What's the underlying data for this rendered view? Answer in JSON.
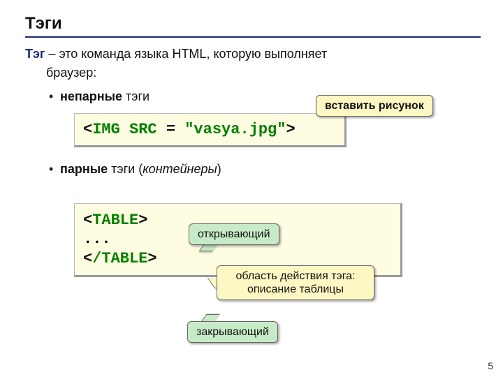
{
  "title": "Тэги",
  "definition": {
    "term": "Тэг",
    "text_after_term": " – это команда языка HTML, которую выполняет",
    "line2": "браузер:"
  },
  "bullets": {
    "first": {
      "bold": "непарные",
      "rest": " тэги"
    },
    "second": {
      "bold": "парные",
      "mid": " тэги (",
      "italic": "контейнеры",
      "end": ")"
    }
  },
  "code1": {
    "lt": "<",
    "tag": "IMG SRC",
    "eq_space": " = ",
    "val": "\"vasya.jpg\"",
    "gt": ">"
  },
  "code2": {
    "open_lt": "<",
    "open_tag": "TABLE",
    "open_gt": ">",
    "dots": "...",
    "close_lt": "<",
    "close_tag": "/TABLE",
    "close_gt": ">"
  },
  "callouts": {
    "insert": "вставить рисунок",
    "opening": "открывающий",
    "closing": "закрывающий",
    "scope_line1": "область действия тэга:",
    "scope_line2": "описание таблицы"
  },
  "page_number": "5"
}
